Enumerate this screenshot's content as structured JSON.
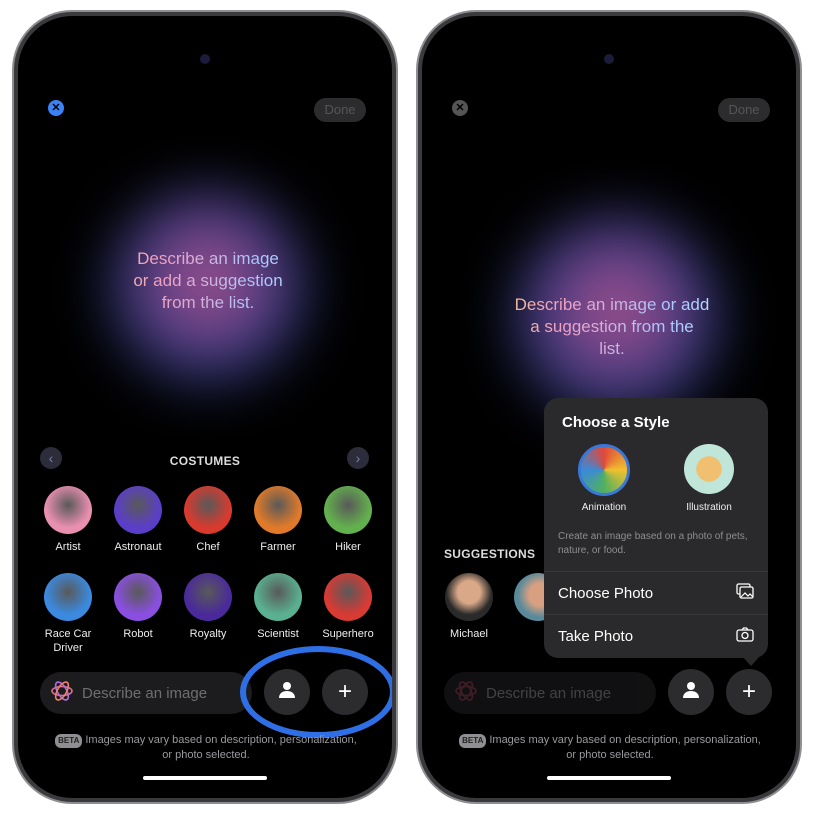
{
  "left": {
    "close_icon": "close-icon",
    "done_label": "Done",
    "prompt": [
      "Describe an image",
      "or add a suggestion",
      "from the list."
    ],
    "section_title": "COSTUMES",
    "costumes": [
      {
        "label": "Artist",
        "color": "#e98fb0"
      },
      {
        "label": "Astronaut",
        "color": "#5b3ec8"
      },
      {
        "label": "Chef",
        "color": "#d83a2e"
      },
      {
        "label": "Farmer",
        "color": "#e07a2a"
      },
      {
        "label": "Hiker",
        "color": "#63b04e"
      },
      {
        "label": "Race Car Driver",
        "color": "#3b8ae0"
      },
      {
        "label": "Robot",
        "color": "#8a4fe0"
      },
      {
        "label": "Royalty",
        "color": "#4a2a9a"
      },
      {
        "label": "Scientist",
        "color": "#5ab090"
      },
      {
        "label": "Superhero",
        "color": "#d83a34"
      }
    ],
    "input_placeholder": "Describe an image",
    "beta_badge": "BETA",
    "disclaimer": [
      "Images may vary based on description, personalization,",
      "or photo selected."
    ],
    "highlight_color": "#2f6fe6"
  },
  "right": {
    "done_label": "Done",
    "prompt": [
      "Describe an image or add",
      "a suggestion from the",
      "list."
    ],
    "section_title": "SUGGESTIONS",
    "people": [
      {
        "label": "Michael"
      }
    ],
    "popup": {
      "title": "Choose a Style",
      "styles": [
        {
          "label": "Animation",
          "selected": true
        },
        {
          "label": "Illustration",
          "selected": false
        }
      ],
      "description": "Create an image based on a photo of pets, nature, or food.",
      "choose_photo": "Choose Photo",
      "take_photo": "Take Photo"
    },
    "input_placeholder": "Describe an image",
    "beta_badge": "BETA",
    "disclaimer": [
      "Images may vary based on description, personalization,",
      "or photo selected."
    ]
  }
}
